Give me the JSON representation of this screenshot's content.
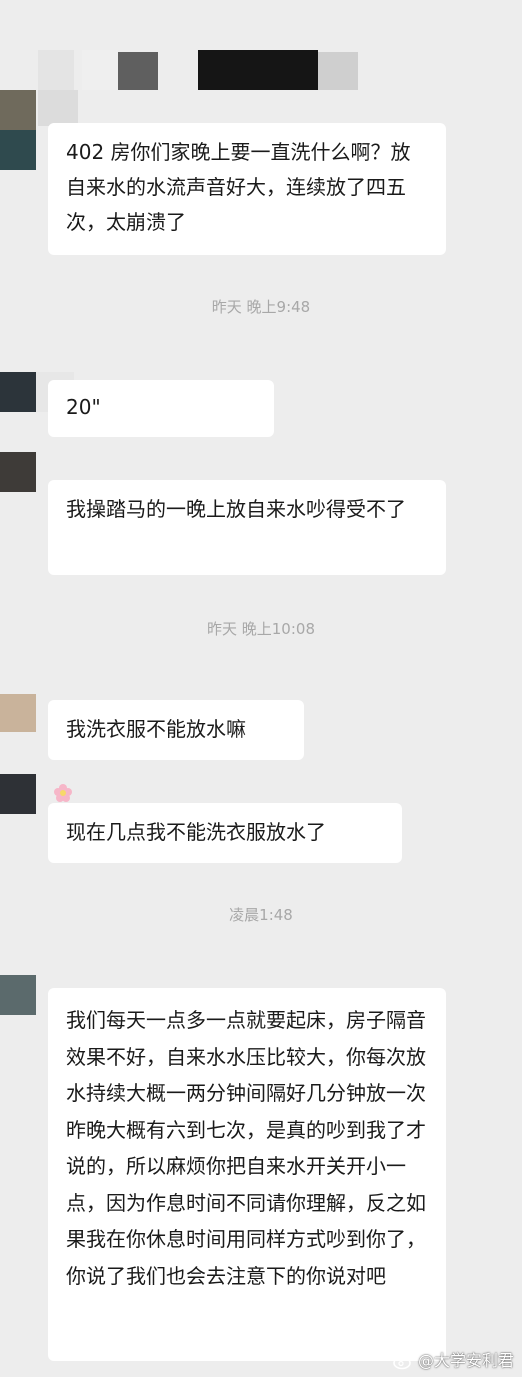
{
  "messages": [
    {
      "text": "402 房你们家晚上要一直洗什么啊？放自来水的水流声音好大，连续放了四五次，太崩溃了"
    },
    {
      "text": "20\""
    },
    {
      "text": "我操踏马的一晚上放自来水吵得受不了"
    },
    {
      "text": "我洗衣服不能放水嘛"
    },
    {
      "text": "现在几点我不能洗衣服放水了"
    },
    {
      "text": "我们每天一点多一点就要起床，房子隔音效果不好，自来水水压比较大，你每次放水持续大概一两分钟间隔好几分钟放一次昨晚大概有六到七次，是真的吵到我了才说的，所以麻烦你把自来水开关开小一点，因为作息时间不同请你理解，反之如果我在你休息时间用同样方式吵到你了，你说了我们也会去注意下的你说对吧"
    }
  ],
  "timestamps": {
    "t1": "昨天 晚上9:48",
    "t2": "昨天 晚上10:08",
    "t3": "凌晨1:48"
  },
  "watermark": {
    "text": "@大学安利君",
    "icon": "weibo-icon"
  },
  "icons": {
    "flower": "flower-icon"
  },
  "colors": {
    "background": "#ededed",
    "bubble": "#ffffff",
    "timestamp": "#a8a8a8"
  }
}
